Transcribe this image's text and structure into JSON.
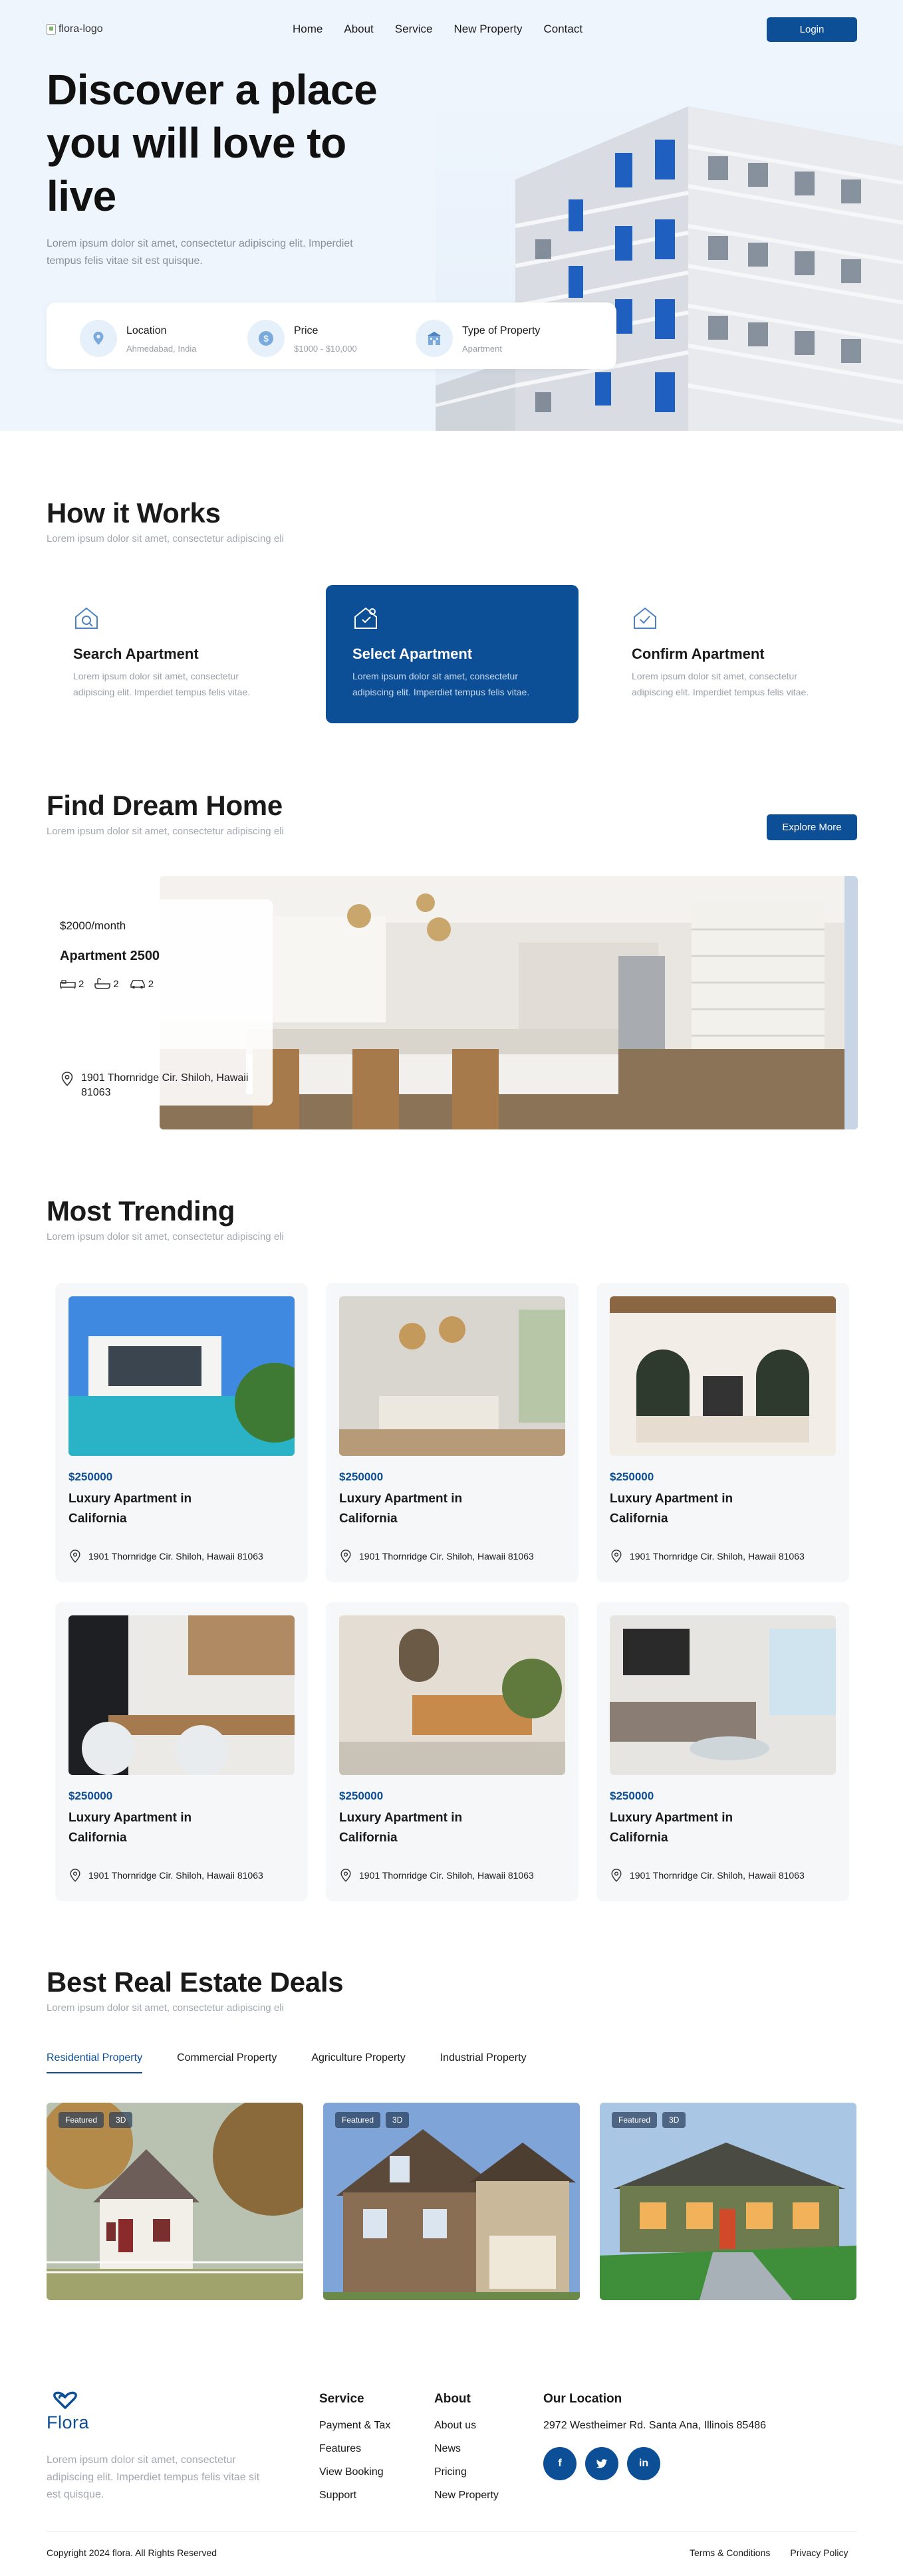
{
  "header": {
    "logo_alt": "flora-logo",
    "nav": [
      "Home",
      "About",
      "Service",
      "New Property",
      "Contact"
    ],
    "login_label": "Login"
  },
  "hero": {
    "title": "Discover a place you will love to live",
    "subtitle": "Lorem ipsum dolor sit amet, consectetur adipiscing elit. Imperdiet tempus felis vitae sit est quisque.",
    "search": [
      {
        "label": "Location",
        "value": "Ahmedabad, India",
        "icon": "location-pin-icon"
      },
      {
        "label": "Price",
        "value": "$1000 - $10,000",
        "icon": "dollar-coin-icon"
      },
      {
        "label": "Type of Property",
        "value": "Apartment",
        "icon": "building-icon"
      }
    ]
  },
  "how_it_works": {
    "title": "How it Works",
    "subtitle": "Lorem ipsum dolor sit amet, consectetur adipiscing eli",
    "steps": [
      {
        "title": "Search Apartment",
        "desc": "Lorem ipsum dolor sit amet, consectetur adipiscing elit. Imperdiet tempus felis vitae."
      },
      {
        "title": "Select Apartment",
        "desc": "Lorem ipsum dolor sit amet, consectetur adipiscing elit. Imperdiet tempus felis vitae."
      },
      {
        "title": "Confirm Apartment",
        "desc": "Lorem ipsum dolor sit amet, consectetur adipiscing elit. Imperdiet tempus felis vitae."
      }
    ]
  },
  "dream_home": {
    "title": "Find Dream Home",
    "subtitle": "Lorem ipsum dolor sit amet, consectetur adipiscing eli",
    "explore_label": "Explore More",
    "price": "$2000/month",
    "name": "Apartment 2500",
    "beds": "2",
    "baths": "2",
    "cars": "2",
    "address": "1901 Thornridge Cir. Shiloh, Hawaii 81063"
  },
  "trending": {
    "title": "Most Trending",
    "subtitle": "Lorem ipsum dolor sit amet, consectetur adipiscing eli",
    "cards": [
      {
        "price": "$250000",
        "name": "Luxury Apartment in California",
        "address": "1901 Thornridge Cir. Shiloh, Hawaii 81063"
      },
      {
        "price": "$250000",
        "name": "Luxury Apartment in California",
        "address": "1901 Thornridge Cir. Shiloh, Hawaii 81063"
      },
      {
        "price": "$250000",
        "name": "Luxury Apartment in California",
        "address": "1901 Thornridge Cir. Shiloh, Hawaii 81063"
      },
      {
        "price": "$250000",
        "name": "Luxury Apartment in California",
        "address": "1901 Thornridge Cir. Shiloh, Hawaii 81063"
      },
      {
        "price": "$250000",
        "name": "Luxury Apartment in California",
        "address": "1901 Thornridge Cir. Shiloh, Hawaii 81063"
      },
      {
        "price": "$250000",
        "name": "Luxury Apartment in California",
        "address": "1901 Thornridge Cir. Shiloh, Hawaii 81063"
      }
    ]
  },
  "deals": {
    "title": "Best Real Estate Deals",
    "subtitle": "Lorem ipsum dolor sit amet, consectetur adipiscing eli",
    "tabs": [
      "Residential Property",
      "Commercial Property",
      "Agriculture Property",
      "Industrial Property"
    ],
    "active_tab": "Residential Property",
    "badge_featured": "Featured",
    "badge_3d": "3D"
  },
  "footer": {
    "brand": "Flora",
    "description": "Lorem ipsum dolor sit amet, consectetur adipiscing elit. Imperdiet tempus felis vitae sit est quisque.",
    "service_title": "Service",
    "service_links": [
      "Payment & Tax",
      "Features",
      "View Booking",
      "Support"
    ],
    "about_title": "About",
    "about_links": [
      "About us",
      "News",
      "Pricing",
      "New Property"
    ],
    "location_title": "Our Location",
    "location_address": "2972 Westheimer Rd. Santa Ana, Illinois 85486",
    "social": [
      "f",
      "t",
      "in"
    ],
    "copyright": "Copyright 2024 flora. All Rights Reserved",
    "bottom_links": [
      "Terms & Conditions",
      "Privacy Policy"
    ]
  },
  "colors": {
    "primary": "#0d4f96",
    "hero_bg": "#eef5fd",
    "muted": "#a3a8b0",
    "card_bg": "#f6f7f8"
  }
}
